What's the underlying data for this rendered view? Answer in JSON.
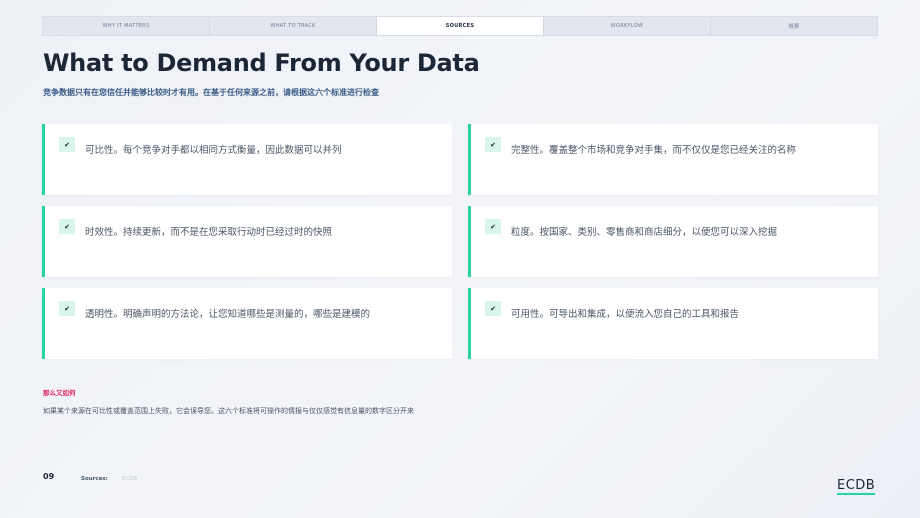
{
  "nav": {
    "tabs": [
      {
        "label": "WHY IT MATTERS",
        "active": false
      },
      {
        "label": "WHAT TO TRACK",
        "active": false
      },
      {
        "label": "SOURCES",
        "active": true
      },
      {
        "label": "WORKFLOW",
        "active": false
      },
      {
        "label": "概要",
        "active": false
      }
    ]
  },
  "header": {
    "title": "What to Demand From Your Data",
    "subtitle": "竞争数据只有在您信任并能够比较时才有用。在基于任何来源之前，请根据这六个标准进行检查"
  },
  "criteria": [
    {
      "icon": "check-icon",
      "glyph": "✔",
      "text": "可比性。每个竞争对手都以相同方式衡量，因此数据可以并列"
    },
    {
      "icon": "check-icon",
      "glyph": "✔",
      "text": "完整性。覆盖整个市场和竞争对手集，而不仅仅是您已经关注的名称"
    },
    {
      "icon": "check-icon",
      "glyph": "✔",
      "text": "时效性。持续更新，而不是在您采取行动时已经过时的快照"
    },
    {
      "icon": "check-icon",
      "glyph": "✔",
      "text": "粒度。按国家、类别、零售商和商店细分，以便您可以深入挖掘"
    },
    {
      "icon": "check-icon",
      "glyph": "✔",
      "text": "透明性。明确声明的方法论，让您知道哪些是测量的，哪些是建模的"
    },
    {
      "icon": "check-icon",
      "glyph": "✔",
      "text": "可用性。可导出和集成，以便流入您自己的工具和报告"
    }
  ],
  "callout": {
    "kicker": "那么又如何",
    "summary": "如果某个来源在可比性或覆盖范围上失败，它会误导您。这六个标准将可操作的情报与仅仅感觉有信息量的数字区分开来"
  },
  "footer": {
    "page_number": "09",
    "sources_label": "Sources:",
    "sources_value": "ECDB",
    "logo": "ECDB"
  },
  "colors": {
    "accent": "#2ad4a1",
    "kicker": "#e0245e",
    "subtitle": "#3a5c86",
    "title": "#1b2636"
  }
}
